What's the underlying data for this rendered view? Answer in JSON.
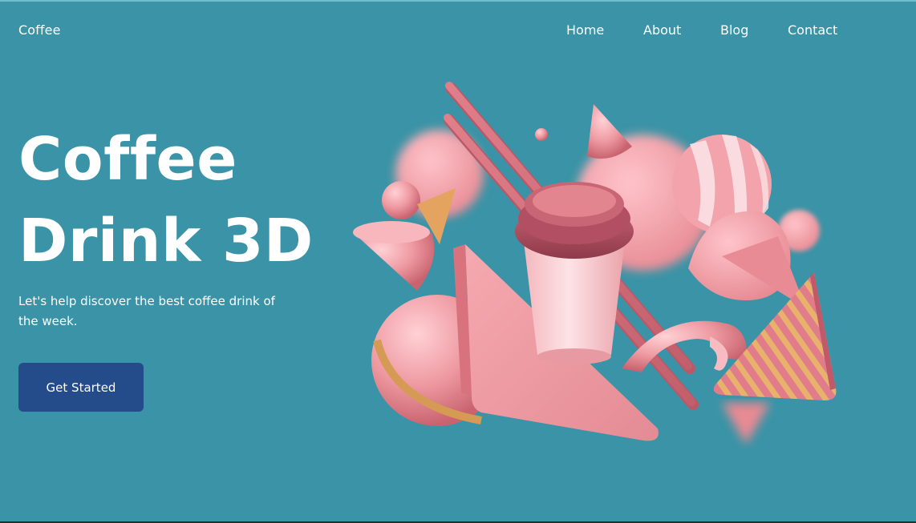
{
  "header": {
    "brand": "Coffee",
    "nav": [
      {
        "label": "Home"
      },
      {
        "label": "About"
      },
      {
        "label": "Blog"
      },
      {
        "label": "Contact"
      }
    ]
  },
  "hero": {
    "title_line1": "Coffee",
    "title_line2": "Drink 3D",
    "subtitle": "Let's help discover the best coffee drink of the week.",
    "cta_label": "Get Started"
  },
  "colors": {
    "background": "#3a93a6",
    "button": "#244c8a",
    "text": "#ffffff",
    "accent_pink": "#e8868f"
  }
}
